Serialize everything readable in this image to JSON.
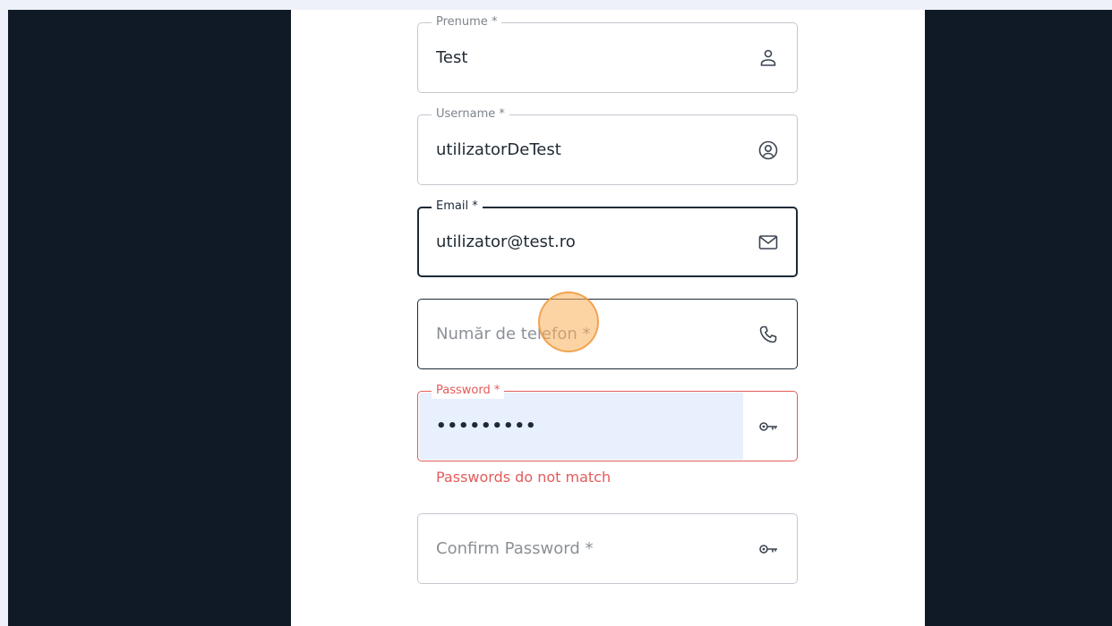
{
  "form": {
    "prenume": {
      "label": "Prenume *",
      "value": "Test",
      "icon": "person-icon"
    },
    "username": {
      "label": "Username *",
      "value": "utilizatorDeTest",
      "icon": "account-circle-icon"
    },
    "email": {
      "label": "Email *",
      "value": "utilizator@test.ro",
      "icon": "mail-icon"
    },
    "phone": {
      "placeholder": "Număr de telefon *",
      "icon": "phone-icon"
    },
    "password": {
      "label": "Password *",
      "value": "•••••••••",
      "icon": "key-icon",
      "error": "Passwords do not match"
    },
    "confirm_password": {
      "placeholder": "Confirm Password *",
      "icon": "key-icon"
    }
  },
  "colors": {
    "frame": "#101a26",
    "page_bg": "#eef1f9",
    "card": "#ffffff",
    "border": "#c4c8cf",
    "focused": "#1b2a38",
    "error": "#e35b5b",
    "autofill": "#e8f0fe",
    "click_marker": "#fab05a"
  }
}
